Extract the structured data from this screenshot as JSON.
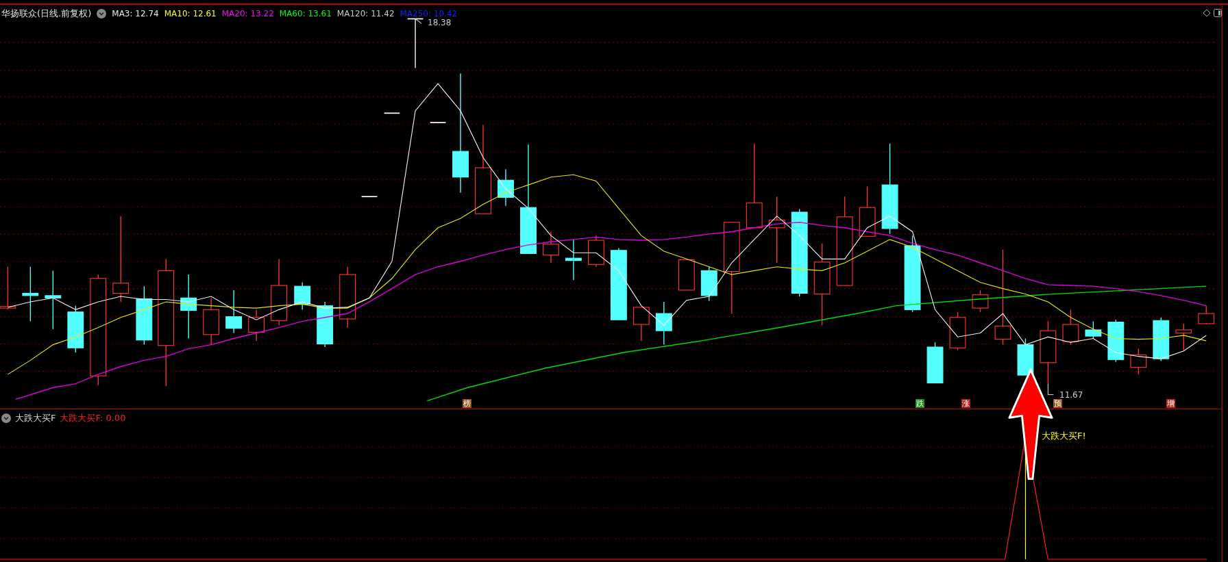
{
  "chart_header": {
    "title": "华扬联众(日线.前复权)",
    "moving_averages": [
      {
        "label": "MA3: 12.74",
        "color": "#e8e8e8"
      },
      {
        "label": "MA10: 12.61",
        "color": "#ffff00"
      },
      {
        "label": "MA20: 13.22",
        "color": "#ff00ff"
      },
      {
        "label": "MA60: 13.61",
        "color": "#00ff00"
      },
      {
        "label": "MA120: 11.42",
        "color": "#c8c8c8"
      },
      {
        "label": "MA250: 10.42",
        "color": "#1e1eff"
      }
    ]
  },
  "price_labels": [
    {
      "text": "18.38",
      "kind": "high"
    },
    {
      "text": "11.67",
      "kind": "low"
    }
  ],
  "signal_markers": [
    {
      "text": "榜",
      "color": "#a0521e"
    },
    {
      "text": "跌",
      "color": "#1e8c1e"
    },
    {
      "text": "涨",
      "color": "#b41e1e"
    },
    {
      "text": "预",
      "color": "#a0521e"
    },
    {
      "text": "增",
      "color": "#b4281e"
    }
  ],
  "indicator_panel": {
    "name": "大跌大买F",
    "value_label": "大跌大买F: 0.00",
    "signal_text": "大跌大买F!"
  }
}
